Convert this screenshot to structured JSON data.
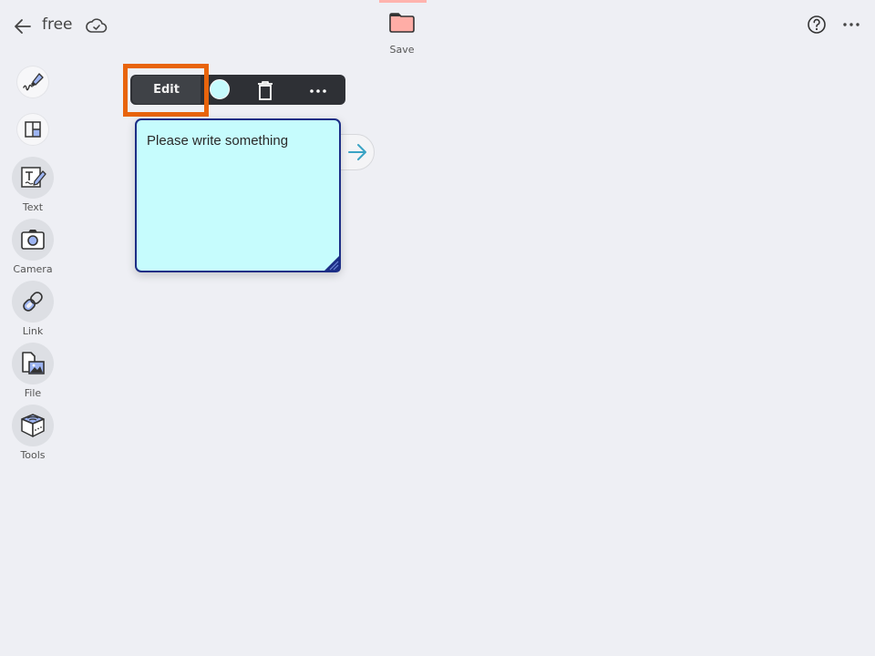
{
  "header": {
    "back_icon": "arrow-left-icon",
    "title": "free",
    "sync_icon": "cloud-check-icon",
    "save": {
      "icon": "folder-icon",
      "label": "Save",
      "icon_color": "#ffada6"
    },
    "help_icon": "question-circle-icon",
    "more_icon": "ellipsis-horizontal-icon"
  },
  "sidebar": {
    "items": [
      {
        "id": "pen",
        "icon": "marker-pen-icon",
        "label": ""
      },
      {
        "id": "layout",
        "icon": "layout-grid-icon",
        "label": ""
      },
      {
        "id": "text",
        "icon": "text-edit-icon",
        "label": "Text"
      },
      {
        "id": "camera",
        "icon": "camera-icon",
        "label": "Camera"
      },
      {
        "id": "link",
        "icon": "link-icon",
        "label": "Link"
      },
      {
        "id": "file",
        "icon": "file-image-icon",
        "label": "File"
      },
      {
        "id": "tools",
        "icon": "toolbox-icon",
        "label": "Tools"
      }
    ]
  },
  "context_toolbar": {
    "edit_label": "Edit",
    "color_icon": "color-swatch-icon",
    "current_color": "#c6fbfd",
    "delete_icon": "trash-icon",
    "more_icon": "ellipsis-horizontal-icon",
    "highlight_color": "#e8640c"
  },
  "sticky_note": {
    "text": "Please write something",
    "background": "#c6fcfd",
    "border_color": "#1c2e86",
    "connector_icon": "arrow-right-icon",
    "resize_icon": "resize-handle-icon"
  }
}
